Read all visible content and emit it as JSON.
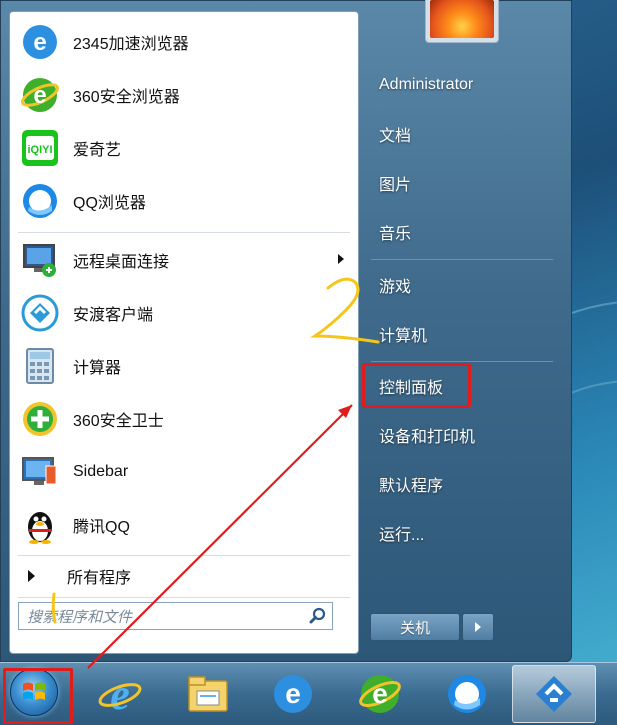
{
  "left_pane": {
    "programs": [
      {
        "label": "2345加速浏览器",
        "icon": "ie-browser-icon"
      },
      {
        "label": "360安全浏览器",
        "icon": "360-browser-icon"
      },
      {
        "label": "爱奇艺",
        "icon": "iqiyi-icon"
      },
      {
        "label": "QQ浏览器",
        "icon": "qq-browser-icon"
      },
      {
        "label": "远程桌面连接",
        "icon": "remote-desktop-icon",
        "has_submenu": true
      },
      {
        "label": "安渡客户端",
        "icon": "andu-client-icon"
      },
      {
        "label": "计算器",
        "icon": "calculator-icon"
      },
      {
        "label": "360安全卫士",
        "icon": "360-safe-icon"
      },
      {
        "label": "Sidebar",
        "icon": "sidebar-icon"
      },
      {
        "label": "腾讯QQ",
        "icon": "qq-penguin-icon"
      }
    ],
    "all_programs": "所有程序",
    "search_placeholder": "搜索程序和文件"
  },
  "right_pane": {
    "user": "Administrator",
    "items": [
      "文档",
      "图片",
      "音乐",
      "游戏",
      "计算机",
      "控制面板",
      "设备和打印机",
      "默认程序",
      "运行..."
    ],
    "shutdown_label": "关机"
  },
  "annotations": {
    "step1": "1",
    "step2": "2"
  },
  "colors": {
    "highlight": "#e21b1b",
    "annotation": "#f5c518"
  }
}
